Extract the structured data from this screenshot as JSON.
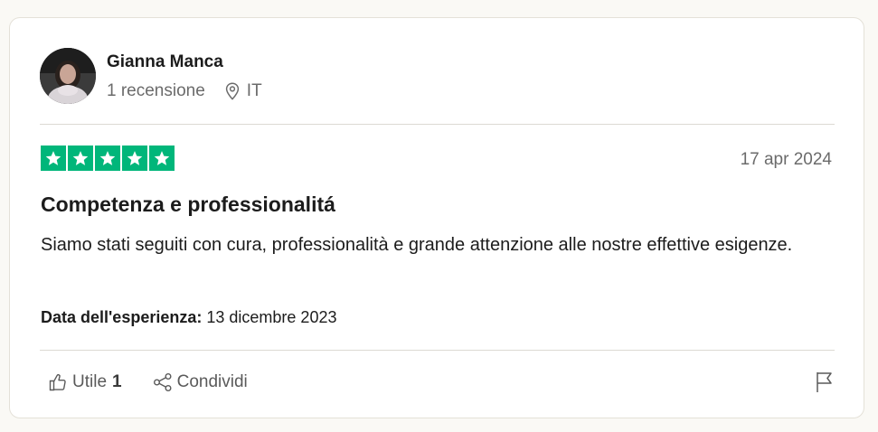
{
  "reviewer": {
    "name": "Gianna Manca",
    "reviews_count": "1 recensione",
    "country": "IT",
    "avatar_icon": "avatar-photo",
    "location_icon": "location-pin-icon"
  },
  "review": {
    "rating": 5,
    "rating_max": 5,
    "star_color": "#00b67a",
    "date": "17 apr 2024",
    "title": "Competenza e professionalitá",
    "body": "Siamo stati seguiti con cura, professionalità e grande attenzione alle nostre effettive esigenze.",
    "experience_label": "Data dell'esperienza:",
    "experience_date": "13 dicembre 2023"
  },
  "actions": {
    "useful_label": "Utile",
    "useful_count": "1",
    "useful_icon": "thumbs-up-icon",
    "share_label": "Condividi",
    "share_icon": "share-icon",
    "flag_icon": "flag-icon"
  }
}
